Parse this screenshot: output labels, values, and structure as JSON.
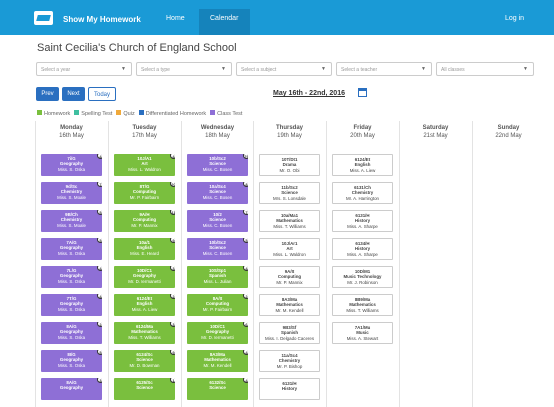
{
  "header": {
    "brand": "Show My Homework",
    "nav_home": "Home",
    "nav_calendar": "Calendar",
    "login": "Log in"
  },
  "school": "Saint Cecilia's Church of England School",
  "filters": {
    "year": "Select a year",
    "type": "Select a type",
    "subject": "Select a subject",
    "teacher": "Select a teacher",
    "classes": "All classes"
  },
  "buttons": {
    "prev": "Prev",
    "next": "Next",
    "today": "Today"
  },
  "date_range": "May 16th - 22nd, 2016",
  "legend": [
    {
      "label": "Homework",
      "color": "#7abf3e"
    },
    {
      "label": "Spelling Test",
      "color": "#3fbfa0"
    },
    {
      "label": "Quiz",
      "color": "#f0a93a"
    },
    {
      "label": "Differentiated Homework",
      "color": "#2a6fc0"
    },
    {
      "label": "Class Test",
      "color": "#8e6fd6"
    }
  ],
  "days": [
    {
      "name": "Monday",
      "date": "16th May"
    },
    {
      "name": "Tuesday",
      "date": "17th May"
    },
    {
      "name": "Wednesday",
      "date": "18th May"
    },
    {
      "name": "Thursday",
      "date": "19th May"
    },
    {
      "name": "Friday",
      "date": "20th May"
    },
    {
      "name": "Saturday",
      "date": "21st May"
    },
    {
      "name": "Sunday",
      "date": "22nd May"
    }
  ],
  "columns": [
    [
      {
        "c": "7i/G",
        "s": "Geography",
        "t": "Miss. S. Oska",
        "k": "purple",
        "n": "4"
      },
      {
        "c": "9d/Sc",
        "s": "Chemistry",
        "t": "Miss. S. Moale",
        "k": "purple",
        "n": "7"
      },
      {
        "c": "9B/Ch",
        "s": "Chemistry",
        "t": "Miss. S. Moale",
        "k": "purple",
        "n": "5"
      },
      {
        "c": "7A/G",
        "s": "Geography",
        "t": "Miss. S. Oska",
        "k": "purple",
        "n": "5"
      },
      {
        "c": "7L/G",
        "s": "Geography",
        "t": "Miss. S. Oska",
        "k": "purple",
        "n": "4"
      },
      {
        "c": "7T/G",
        "s": "Geography",
        "t": "Miss. S. Oska",
        "k": "purple",
        "n": "4"
      },
      {
        "c": "8A/G",
        "s": "Geography",
        "t": "Miss. S. Oska",
        "k": "purple",
        "n": "2"
      },
      {
        "c": "8I/G",
        "s": "Geography",
        "t": "Miss. S. Oska",
        "k": "purple",
        "n": "5"
      },
      {
        "c": "8A/G",
        "s": "Geography",
        "t": "",
        "k": "purple",
        "n": "3"
      }
    ],
    [
      {
        "c": "10J/A1",
        "s": "Art",
        "t": "Miss. L. Waldron",
        "k": "green",
        "n": "4"
      },
      {
        "c": "8T/G",
        "s": "Computing",
        "t": "Mr. P. Fairbairn",
        "k": "green",
        "n": "20"
      },
      {
        "c": "9A/H",
        "s": "Computing",
        "t": "Mr. P. Mannix",
        "k": "green",
        "n": "11"
      },
      {
        "c": "10a/1",
        "s": "English",
        "t": "Miss. E. Heard",
        "k": "green",
        "n": "9"
      },
      {
        "c": "10D/C1",
        "s": "Geography",
        "t": "Mr. D. Iermanetti",
        "k": "green",
        "n": "3"
      },
      {
        "c": "6124/Et",
        "s": "English",
        "t": "Miss. A. Liew",
        "k": "green",
        "n": "2"
      },
      {
        "c": "6124/Ma",
        "s": "Mathematics",
        "t": "Miss. T. Williams",
        "k": "green",
        "n": "3"
      },
      {
        "c": "6124/Sc",
        "s": "Science",
        "t": "Mr. D. Bowman",
        "k": "green",
        "n": "9"
      },
      {
        "c": "6125/Sc",
        "s": "Science",
        "t": "",
        "k": "green",
        "n": "1"
      }
    ],
    [
      {
        "c": "10b/Sc2",
        "s": "Science",
        "t": "Miss. C. Bosen",
        "k": "purple",
        "n": "76"
      },
      {
        "c": "10a/Sc4",
        "s": "Science",
        "t": "Miss. C. Bosen",
        "k": "purple",
        "n": "8"
      },
      {
        "c": "10/2",
        "s": "Science",
        "t": "Miss. C. Bosen",
        "k": "purple",
        "n": "7"
      },
      {
        "c": "10b/Sc2",
        "s": "Science",
        "t": "Miss. C. Bosen",
        "k": "purple",
        "n": "5"
      },
      {
        "c": "10S/Sp1",
        "s": "Spanish",
        "t": "Miss. L. Julian",
        "k": "green",
        "n": "4"
      },
      {
        "c": "8A/It",
        "s": "Computing",
        "t": "Mr. P. Fairbairn",
        "k": "green",
        "n": "2"
      },
      {
        "c": "10D/C1",
        "s": "Geography",
        "t": "Mr. D. Iermanetti",
        "k": "green",
        "n": "6"
      },
      {
        "c": "8A3/Ma",
        "s": "Mathematics",
        "t": "Mr. M. Kendell",
        "k": "green",
        "n": "4"
      },
      {
        "c": "6132/Sc",
        "s": "Science",
        "t": "",
        "k": "green",
        "n": "4"
      }
    ],
    [
      {
        "c": "10T/Dt1",
        "s": "Drama",
        "t": "Mr. O. Obi",
        "k": "white",
        "n": ""
      },
      {
        "c": "11b/Sc2",
        "s": "Science",
        "t": "Mrs. S. Lonsdale",
        "k": "white",
        "n": ""
      },
      {
        "c": "10a/Ma1",
        "s": "Mathematics",
        "t": "Miss. T. Williams",
        "k": "white",
        "n": ""
      },
      {
        "c": "10J/Ar1",
        "s": "Art",
        "t": "Miss. L. Waldron",
        "k": "white",
        "n": ""
      },
      {
        "c": "9A/It",
        "s": "Computing",
        "t": "Mr. P. Mannix",
        "k": "white",
        "n": ""
      },
      {
        "c": "8A3/Ma",
        "s": "Mathematics",
        "t": "Mr. M. Kendell",
        "k": "white",
        "n": ""
      },
      {
        "c": "9B3/Sf",
        "s": "Spanish",
        "t": "Miss. I. Delgado Caceres",
        "k": "white",
        "n": ""
      },
      {
        "c": "11a/Sc4",
        "s": "Chemistry",
        "t": "Mr. P. Bishop",
        "k": "white",
        "n": ""
      },
      {
        "c": "6131/H",
        "s": "History",
        "t": "",
        "k": "white",
        "n": ""
      }
    ],
    [
      {
        "c": "6124/Et",
        "s": "English",
        "t": "Miss. A. Liew",
        "k": "white",
        "n": ""
      },
      {
        "c": "6131/Ch",
        "s": "Chemistry",
        "t": "Mr. A. Harrington",
        "k": "white",
        "n": ""
      },
      {
        "c": "6131/H",
        "s": "History",
        "t": "Miss. A. Sharpe",
        "k": "white",
        "n": ""
      },
      {
        "c": "6134/H",
        "s": "History",
        "t": "Miss. A. Sharpe",
        "k": "white",
        "n": ""
      },
      {
        "c": "10D/M1",
        "s": "Music Technology",
        "t": "Mr. J. Robinson",
        "k": "white",
        "n": ""
      },
      {
        "c": "8B9/Ma",
        "s": "Mathematics",
        "t": "Miss. T. Williams",
        "k": "white",
        "n": ""
      },
      {
        "c": "7A1/Mu",
        "s": "Music",
        "t": "Miss. A. Stewart",
        "k": "white",
        "n": ""
      }
    ],
    [],
    []
  ]
}
